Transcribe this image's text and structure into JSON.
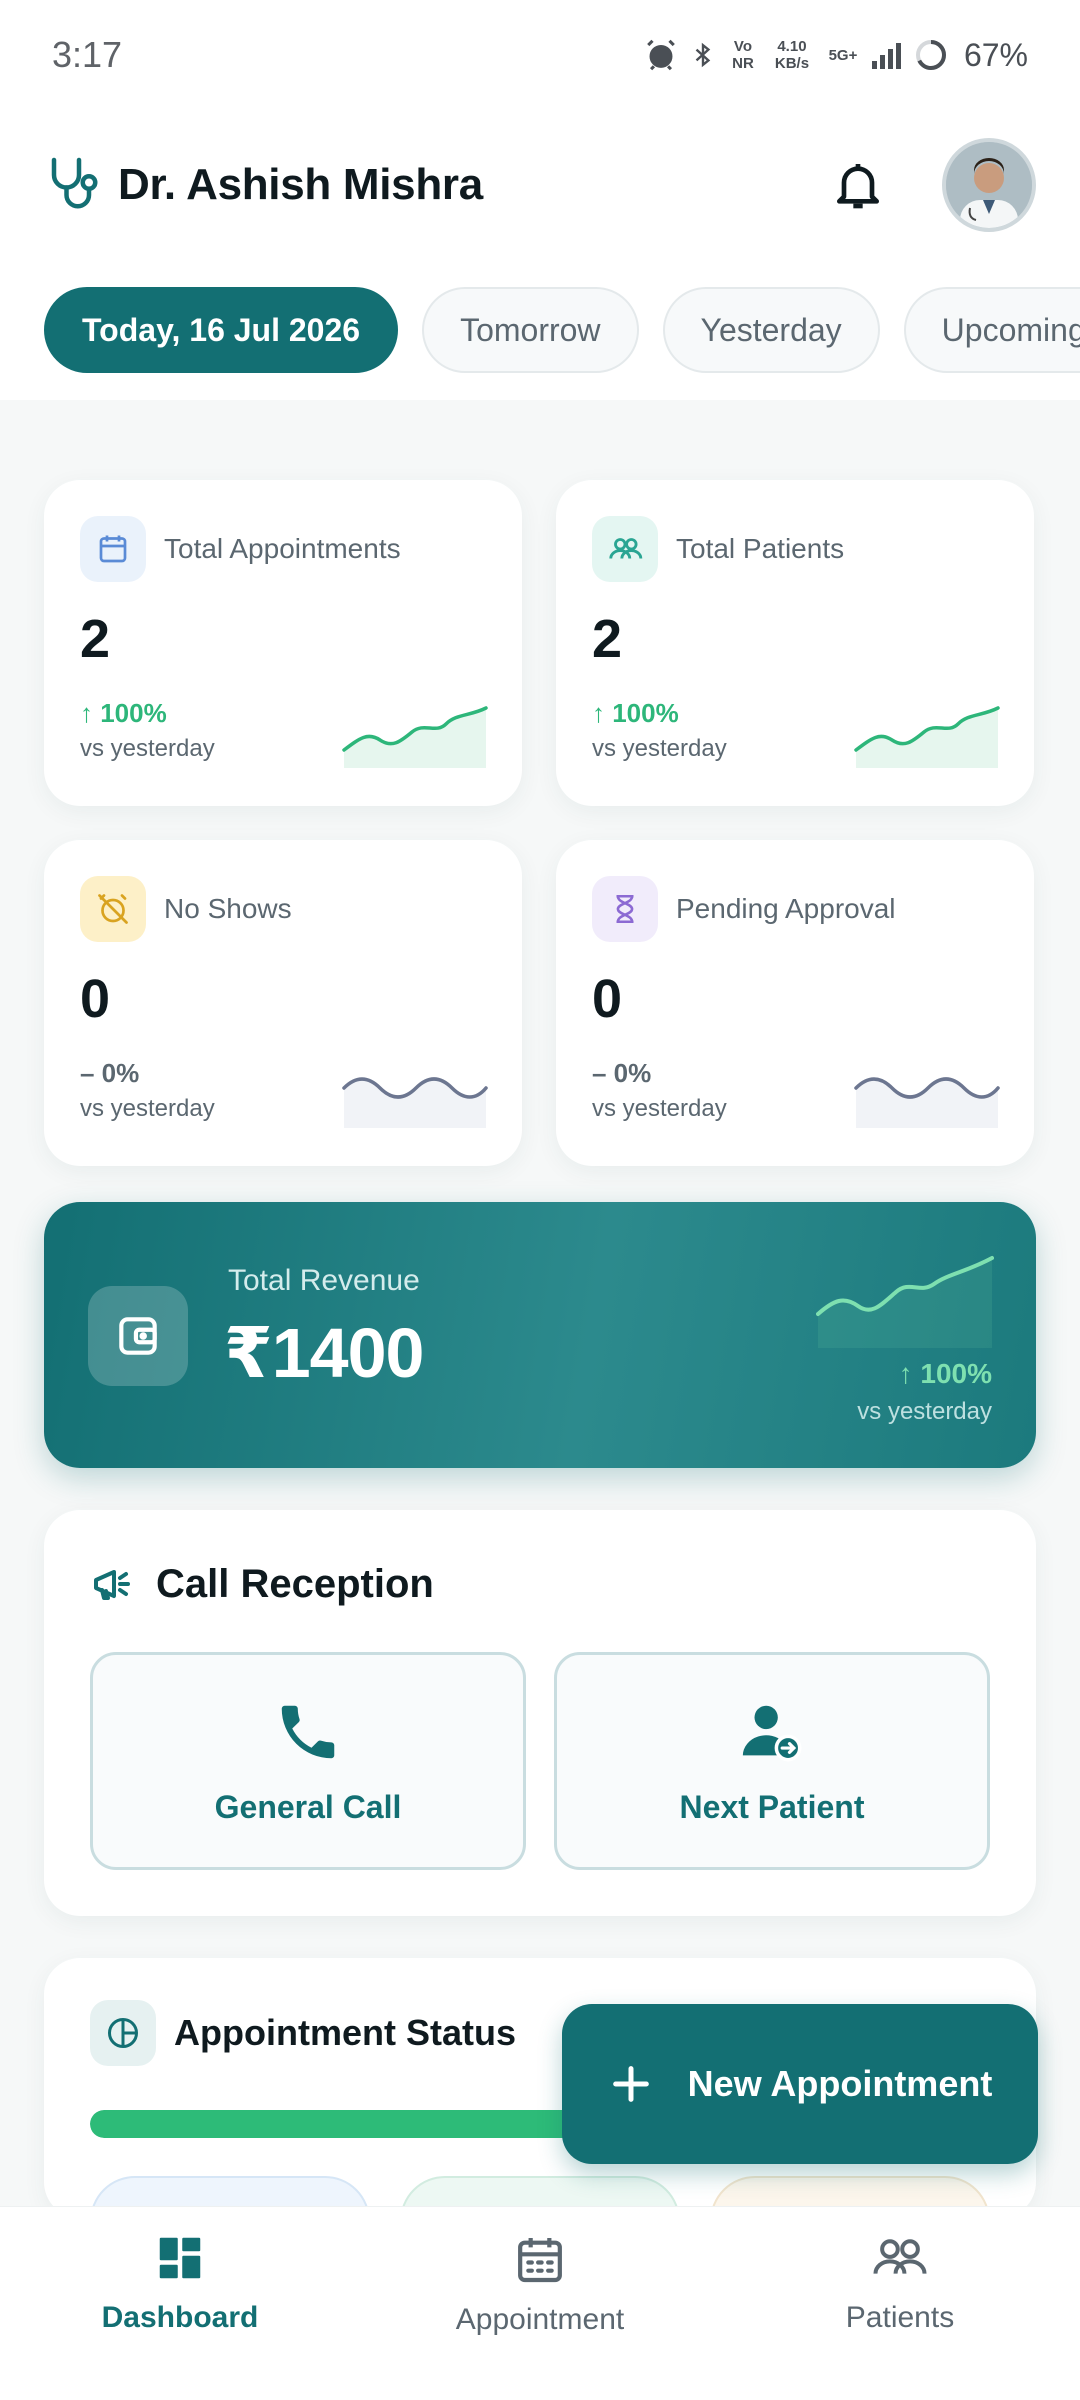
{
  "status_bar": {
    "time": "3:17",
    "volte": "Vo NR",
    "net_speed": "4.10 KB/s",
    "network": "5G+",
    "battery": "67%"
  },
  "header": {
    "title": "Dr. Ashish Mishra",
    "logo_icon": "stethoscope-icon",
    "notification_icon": "bell-icon"
  },
  "date_tabs": [
    {
      "label": "Today, 16 Jul 2026",
      "active": true
    },
    {
      "label": "Tomorrow",
      "active": false
    },
    {
      "label": "Yesterday",
      "active": false
    },
    {
      "label": "Upcoming",
      "active": false
    }
  ],
  "stats": [
    {
      "label": "Total Appointments",
      "value": "2",
      "change": "↑ 100%",
      "sub": "vs yesterday",
      "icon": "calendar-icon",
      "trend": "up"
    },
    {
      "label": "Total Patients",
      "value": "2",
      "change": "↑ 100%",
      "sub": "vs yesterday",
      "icon": "users-icon",
      "trend": "up"
    },
    {
      "label": "No Shows",
      "value": "0",
      "change": "– 0%",
      "sub": "vs yesterday",
      "icon": "alarm-off-icon",
      "trend": "flat"
    },
    {
      "label": "Pending Approval",
      "value": "0",
      "change": "– 0%",
      "sub": "vs yesterday",
      "icon": "hourglass-icon",
      "trend": "flat"
    }
  ],
  "revenue": {
    "label": "Total Revenue",
    "value": "₹1400",
    "change": "↑ 100%",
    "sub": "vs yesterday",
    "icon": "wallet-icon"
  },
  "call_reception": {
    "title": "Call Reception",
    "icon": "megaphone-icon",
    "buttons": [
      {
        "label": "General Call",
        "icon": "phone-icon"
      },
      {
        "label": "Next Patient",
        "icon": "user-next-icon"
      }
    ]
  },
  "appointment_status": {
    "title": "Appointment Status",
    "icon": "pie-chart-icon",
    "progress_fraction": 0.58
  },
  "fab": {
    "label": "New Appointment",
    "icon": "plus-icon"
  },
  "bottom_nav": [
    {
      "label": "Dashboard",
      "icon": "dashboard-icon",
      "active": true
    },
    {
      "label": "Appointment",
      "icon": "calendar-icon",
      "active": false
    },
    {
      "label": "Patients",
      "icon": "users-icon",
      "active": false
    }
  ],
  "colors": {
    "primary": "#136f73",
    "success": "#2db67a",
    "text": "#0f1a1f",
    "muted": "#5b6770"
  }
}
